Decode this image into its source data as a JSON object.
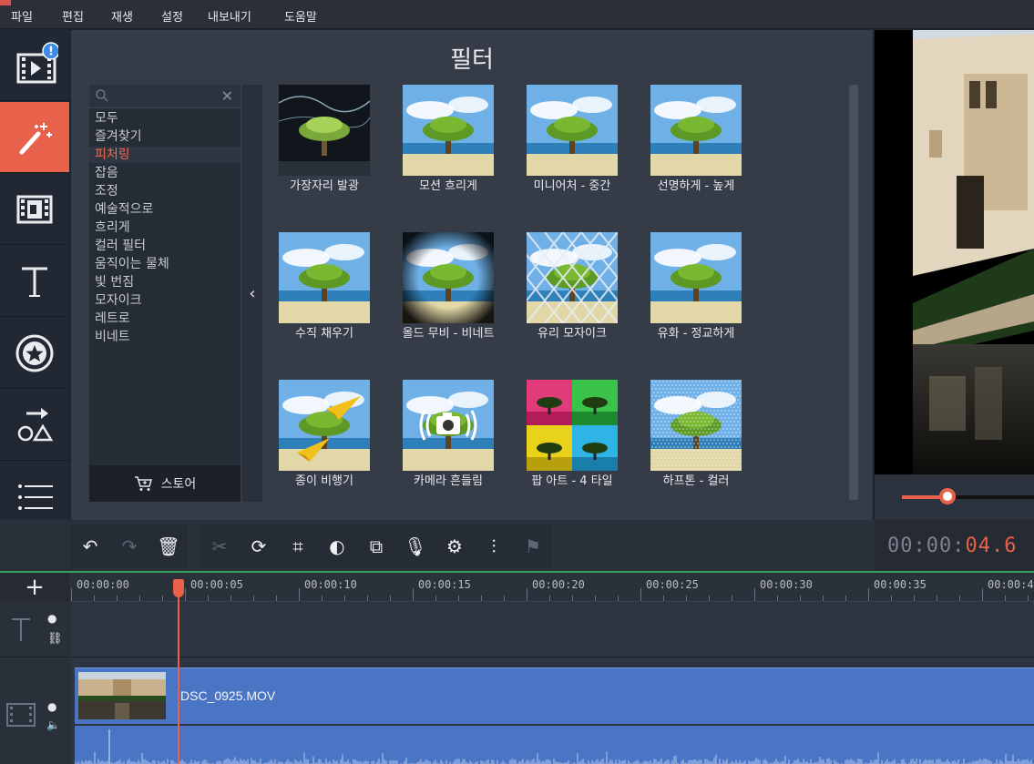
{
  "menu": [
    "파일",
    "편집",
    "재생",
    "설정",
    "내보내기",
    "도움말"
  ],
  "sidebar": {
    "items": [
      {
        "name": "media-import",
        "icon": "film-import-icon",
        "badge": "!"
      },
      {
        "name": "filters",
        "icon": "magic-wand-icon",
        "active": true
      },
      {
        "name": "transitions",
        "icon": "transition-icon"
      },
      {
        "name": "titles",
        "icon": "text-icon"
      },
      {
        "name": "stickers",
        "icon": "sticker-icon"
      },
      {
        "name": "callouts",
        "icon": "shapes-icon"
      },
      {
        "name": "more",
        "icon": "list-icon"
      }
    ]
  },
  "filter_panel": {
    "title": "필터",
    "search_placeholder": "",
    "categories": [
      "모두",
      "즐겨찾기",
      "피처링",
      "잡음",
      "조정",
      "예술적으로",
      "흐리게",
      "컬러 필터",
      "움직이는 물체",
      "빛 번짐",
      "모자이크",
      "레트로",
      "비네트"
    ],
    "selected_category": "피처링",
    "store_label": "스토어",
    "filters": [
      {
        "label": "가장자리 발광",
        "style": "edge-glow"
      },
      {
        "label": "모션 흐리게",
        "style": "normal"
      },
      {
        "label": "미니어처 - 중간",
        "style": "normal"
      },
      {
        "label": "선명하게 - 높게",
        "style": "normal"
      },
      {
        "label": "수직 채우기",
        "style": "normal"
      },
      {
        "label": "올드 무비 - 비네트",
        "style": "vignette"
      },
      {
        "label": "유리 모자이크",
        "style": "glass"
      },
      {
        "label": "유화 - 정교하게",
        "style": "normal"
      },
      {
        "label": "종이 비행기",
        "style": "planes"
      },
      {
        "label": "카메라 흔들림",
        "style": "camera"
      },
      {
        "label": "팝 아트 - 4 타일",
        "style": "pop"
      },
      {
        "label": "하프톤 - 컬러",
        "style": "halftone"
      }
    ]
  },
  "toolbar": {
    "tools": [
      {
        "name": "undo",
        "icon": "undo-icon",
        "glyph": "↶",
        "enabled": true
      },
      {
        "name": "redo",
        "icon": "redo-icon",
        "glyph": "↷",
        "enabled": false
      },
      {
        "name": "delete",
        "icon": "trash-icon",
        "glyph": "🗑",
        "enabled": true
      },
      {
        "name": "cut",
        "icon": "scissors-icon",
        "glyph": "✂",
        "enabled": false
      },
      {
        "name": "rotate",
        "icon": "rotate-icon",
        "glyph": "⟳",
        "enabled": true
      },
      {
        "name": "crop",
        "icon": "crop-icon",
        "glyph": "⌗",
        "enabled": true
      },
      {
        "name": "color",
        "icon": "contrast-icon",
        "glyph": "◐",
        "enabled": true
      },
      {
        "name": "transition-wizard",
        "icon": "frame-icon",
        "glyph": "⧉",
        "enabled": true
      },
      {
        "name": "record",
        "icon": "microphone-icon",
        "glyph": "🎙",
        "enabled": true
      },
      {
        "name": "clip-properties",
        "icon": "gear-icon",
        "glyph": "⚙",
        "enabled": true
      },
      {
        "name": "audio-settings",
        "icon": "equalizer-icon",
        "glyph": "⫶",
        "enabled": true
      },
      {
        "name": "marker",
        "icon": "flag-icon",
        "glyph": "⚑",
        "enabled": false
      }
    ]
  },
  "timecode": {
    "dim": "00:00:",
    "hot": "04.6"
  },
  "timeline": {
    "add_label": "+",
    "ticks": [
      "00:00:00",
      "00:00:05",
      "00:00:10",
      "00:00:15",
      "00:00:20",
      "00:00:25",
      "00:00:30",
      "00:00:35",
      "00:00:4"
    ],
    "clip_name": "DSC_0925.MOV",
    "playhead_seconds": 4.6
  },
  "colors": {
    "accent": "#e8614a",
    "clip": "#4a74c4",
    "panel": "#353c48"
  }
}
